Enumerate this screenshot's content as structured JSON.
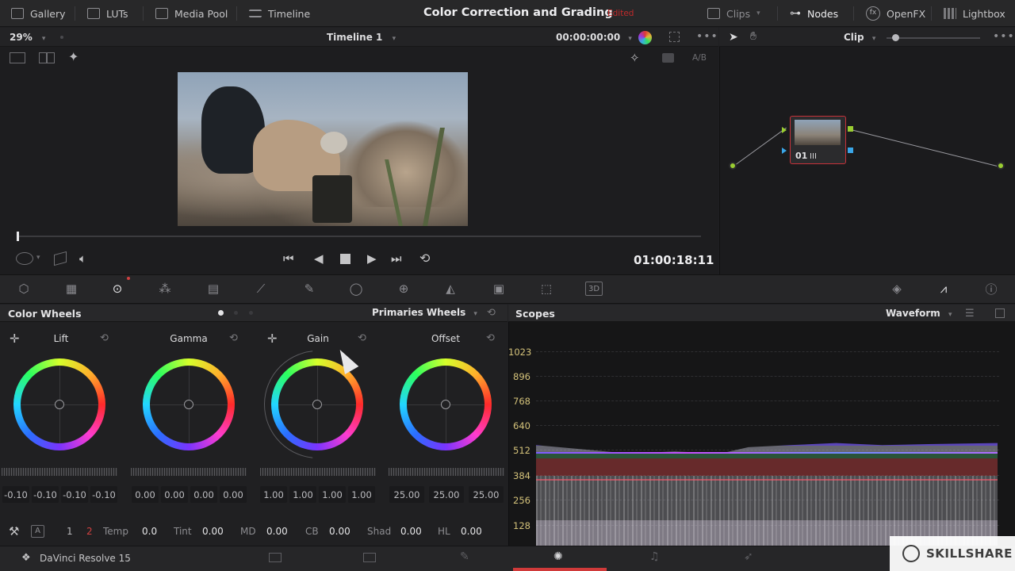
{
  "topbar": {
    "left_items": [
      "Gallery",
      "LUTs",
      "Media Pool",
      "Timeline"
    ],
    "title": "Color Correction and Grading",
    "status": "Edited",
    "right_items": [
      "Clips",
      "Nodes",
      "OpenFX",
      "Lightbox"
    ]
  },
  "viewer": {
    "zoom": "29%",
    "timeline_name": "Timeline 1",
    "source_timecode": "00:00:00:00",
    "ab_label": "A/B",
    "record_timecode": "01:00:18:11"
  },
  "nodes": {
    "mode": "Clip",
    "node_label": "01"
  },
  "color_wheels": {
    "panel_title": "Color Wheels",
    "mode": "Primaries Wheels",
    "wheels": [
      {
        "name": "Lift",
        "values": [
          "-0.10",
          "-0.10",
          "-0.10",
          "-0.10"
        ]
      },
      {
        "name": "Gamma",
        "values": [
          "0.00",
          "0.00",
          "0.00",
          "0.00"
        ]
      },
      {
        "name": "Gain",
        "values": [
          "1.00",
          "1.00",
          "1.00",
          "1.00"
        ]
      },
      {
        "name": "Offset",
        "values": [
          "25.00",
          "25.00",
          "25.00"
        ]
      }
    ],
    "pages": [
      "1",
      "2"
    ],
    "adjustments": [
      {
        "label": "Temp",
        "value": "0.0"
      },
      {
        "label": "Tint",
        "value": "0.00"
      },
      {
        "label": "MD",
        "value": "0.00"
      },
      {
        "label": "CB",
        "value": "0.00"
      },
      {
        "label": "Shad",
        "value": "0.00"
      },
      {
        "label": "HL",
        "value": "0.00"
      }
    ]
  },
  "scopes": {
    "panel_title": "Scopes",
    "mode": "Waveform",
    "y_ticks": [
      "1023",
      "896",
      "768",
      "640",
      "512",
      "384",
      "256",
      "128"
    ]
  },
  "statusbar": {
    "app_name": "DaVinci Resolve 15"
  },
  "watermark": "SKILLSHARE"
}
